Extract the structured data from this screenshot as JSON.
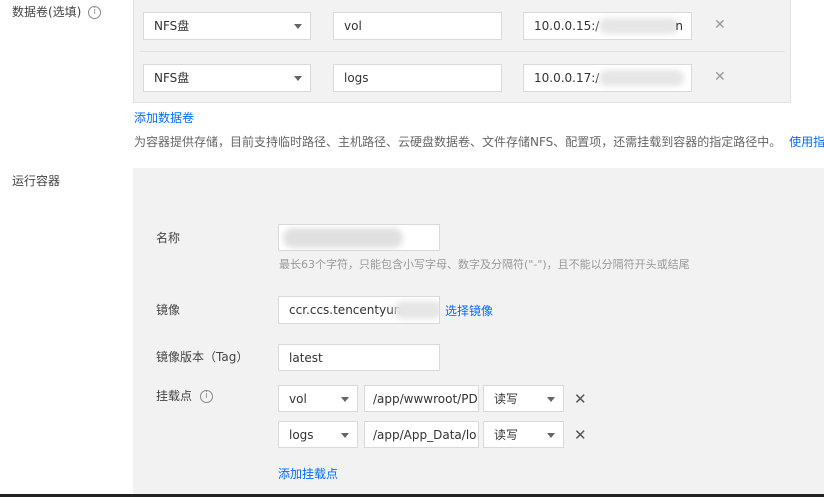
{
  "volumes": {
    "label": "数据卷(选填)",
    "info_icon": "info-circle-icon",
    "rows": [
      {
        "type": "NFS盘",
        "name": "vol",
        "path": "10.0.0.15:/",
        "path_tail": "n"
      },
      {
        "type": "NFS盘",
        "name": "logs",
        "path": "10.0.0.17:/",
        "path_tail": ""
      }
    ],
    "close_icon": "close-icon",
    "add_link": "添加数据卷",
    "help_text": "为容器提供存储，目前支持临时路径、主机路径、云硬盘数据卷、文件存储NFS、配置项，还需挂载到容器的指定路径中。",
    "guide_link": "使用指引"
  },
  "container": {
    "section_label": "运行容器",
    "name_label": "名称",
    "name_value": "",
    "name_hint": "最长63个字符，只能包含小写字母、数字及分隔符(\"-\")，且不能以分隔符开头或结尾",
    "image_label": "镜像",
    "image_value": "ccr.ccs.tencentyun.",
    "select_image_link": "选择镜像",
    "tag_label": "镜像版本（Tag）",
    "tag_value": "latest",
    "mount_label": "挂载点",
    "mounts": [
      {
        "volume": "vol",
        "path": "/app/wwwroot/PD",
        "mode": "读写"
      },
      {
        "volume": "logs",
        "path": "/app/App_Data/lo",
        "mode": "读写"
      }
    ],
    "add_mount_link": "添加挂载点"
  }
}
